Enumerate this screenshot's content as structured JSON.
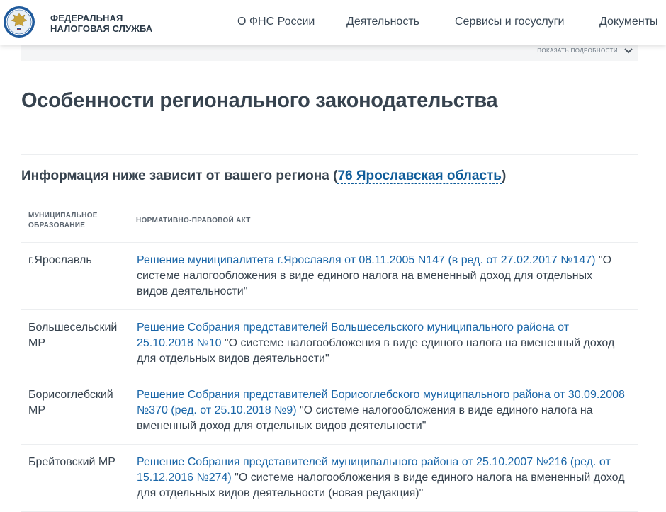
{
  "header": {
    "org_line1": "ФЕДЕРАЛЬНАЯ",
    "org_line2": "НАЛОГОВАЯ СЛУЖБА",
    "nav": [
      "О ФНС России",
      "Деятельность",
      "Сервисы и госуслуги",
      "Документы"
    ]
  },
  "details": {
    "label": "ПОКАЗАТЬ ПОДРОБНОСТИ"
  },
  "page_title": "Особенности регионального законодательства",
  "region": {
    "prefix": "Информация ниже зависит от вашего региона (",
    "link": "76 Ярославская область",
    "suffix": ")"
  },
  "table": {
    "headers": {
      "municipality": "МУНИЦИПАЛЬНОЕ ОБРАЗОВАНИЕ",
      "act": "НОРМАТИВНО-ПРАВОВОЙ АКТ"
    },
    "rows": [
      {
        "municipality": "г.Ярославль",
        "link": "Решение муниципалитета г.Ярославля от 08.11.2005 N147 (в ред. от 27.02.2017 №147)",
        "rest": " \"О системе налогообложения в виде единого налога на вмененный доход для отдельных видов деятельности\""
      },
      {
        "municipality": "Большесельский МР",
        "link": "Решение Собрания представителей Большесельского муниципального района от 25.10.2018 №10",
        "rest": " \"О системе налогообложения в виде единого налога на вмененный доход для отдельных видов деятельности\""
      },
      {
        "municipality": "Борисоглебский МР",
        "link": "Решение Собрания представителей Борисоглебского муниципального района от 30.09.2008 №370 (ред. от 25.10.2018 №9)",
        "rest": " \"О системе налогообложения в виде единого налога на вмененный доход для отдельных видов деятельности\""
      },
      {
        "municipality": "Брейтовский МР",
        "link": "Решение Собрания представителей муниципального района от 25.10.2007 №216 (ред. от 15.12.2016 №274)",
        "rest": " \"О системе налогообложения в виде единого налога на вмененный доход для отдельных видов деятельности (новая редакция)\""
      }
    ]
  }
}
